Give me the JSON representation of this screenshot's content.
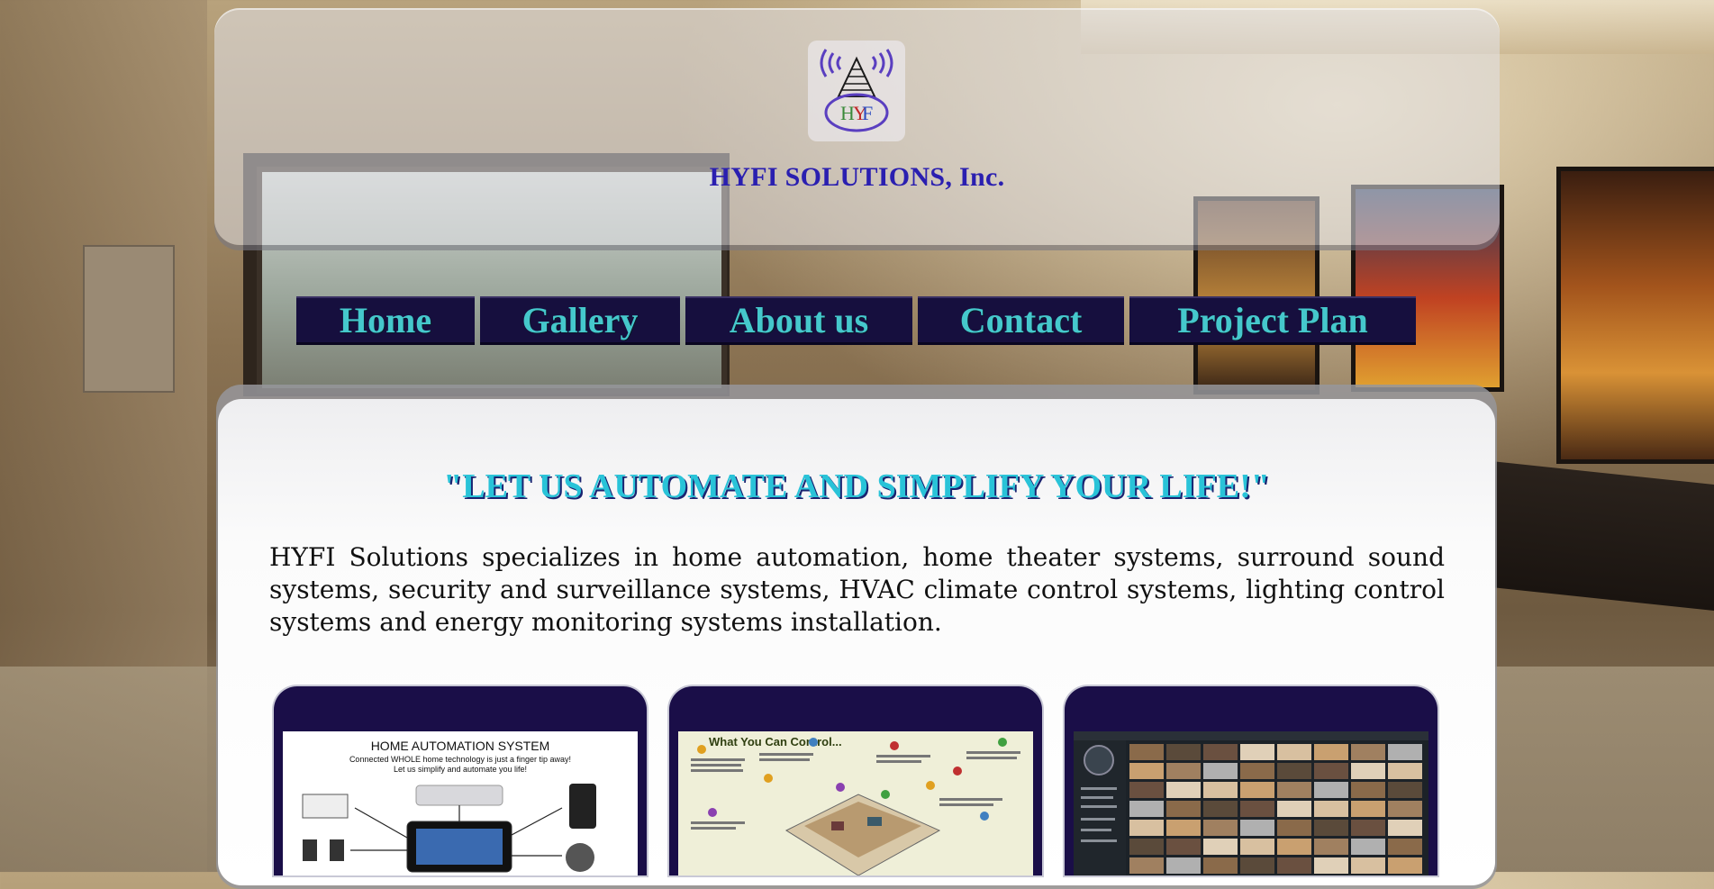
{
  "site": {
    "title": "HYFI SOLUTIONS, Inc.",
    "logo_icon": "hyfi-tower-logo-icon"
  },
  "nav": {
    "items": [
      {
        "label": "Home"
      },
      {
        "label": "Gallery"
      },
      {
        "label": "About us"
      },
      {
        "label": "Contact"
      },
      {
        "label": "Project Plan"
      }
    ]
  },
  "main": {
    "tagline": "\"LET US AUTOMATE AND SIMPLIFY YOUR LIFE!\"",
    "intro": "HYFI Solutions specializes in home automation, home theater systems, surround sound systems, security and surveillance systems, HVAC climate control systems, lighting control systems and energy monitoring systems installation."
  },
  "cards": [
    {
      "title": "HOME AUTOMATION SYSTEM",
      "subtitle_line1": "Connected WHOLE home technology is just a finger tip away!",
      "subtitle_line2": "Let us simplify and automate you life!"
    },
    {
      "title": "What You Can Control..."
    },
    {
      "title": ""
    }
  ],
  "colors": {
    "nav_bg": "#160f3e",
    "nav_text": "#45c8cc",
    "title": "#2a1fb0",
    "tagline": "#29c3d8",
    "card_bg": "#1a0e48"
  }
}
